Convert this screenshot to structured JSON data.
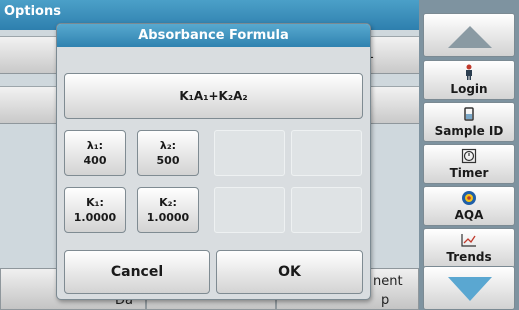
{
  "background": {
    "title": "Options",
    "row1_value": "1",
    "bottom_left": "Da",
    "bottom_right": "nent",
    "bottom_right2": "p"
  },
  "sidebar": {
    "login_label": "Login",
    "sample_id_label": "Sample ID",
    "timer_label": "Timer",
    "aqa_label": "AQA",
    "trends_label": "Trends"
  },
  "dialog": {
    "title": "Absorbance Formula",
    "formula": "K₁A₁+K₂A₂",
    "params": [
      {
        "name": "λ₁:",
        "value": "400"
      },
      {
        "name": "λ₂:",
        "value": "500"
      },
      {
        "name": "K₁:",
        "value": "1.0000"
      },
      {
        "name": "K₂:",
        "value": "1.0000"
      }
    ],
    "cancel_label": "Cancel",
    "ok_label": "OK"
  },
  "colors": {
    "title_bar": "#2f82b0",
    "sidebar_bg": "#7e93a0"
  }
}
